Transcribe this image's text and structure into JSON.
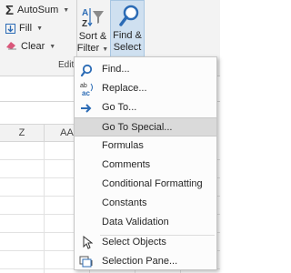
{
  "ribbon": {
    "autosum_label": "AutoSum",
    "fill_label": "Fill",
    "clear_label": "Clear",
    "group_label": "Edit",
    "sort_filter_line1": "Sort &",
    "sort_filter_line2": "Filter",
    "find_select_line1": "Find &",
    "find_select_line2": "Select"
  },
  "sheet": {
    "columns": [
      "Z",
      "AA"
    ]
  },
  "menu": {
    "items": [
      {
        "label": "Find...",
        "icon": "binoculars-icon"
      },
      {
        "label": "Replace...",
        "icon": "replace-icon"
      },
      {
        "label": "Go To...",
        "icon": "arrow-right-icon"
      },
      {
        "label": "Go To Special...",
        "icon": ""
      },
      {
        "label": "Formulas",
        "icon": ""
      },
      {
        "label": "Comments",
        "icon": ""
      },
      {
        "label": "Conditional Formatting",
        "icon": ""
      },
      {
        "label": "Constants",
        "icon": ""
      },
      {
        "label": "Data Validation",
        "icon": ""
      },
      {
        "label": "Select Objects",
        "icon": "cursor-icon"
      },
      {
        "label": "Selection Pane...",
        "icon": "selection-pane-icon"
      }
    ],
    "highlighted_index": 3
  },
  "colors": {
    "accent_blue": "#2b6bb5",
    "highlight": "#dadada",
    "find_select_bg": "#cfe0f0"
  }
}
